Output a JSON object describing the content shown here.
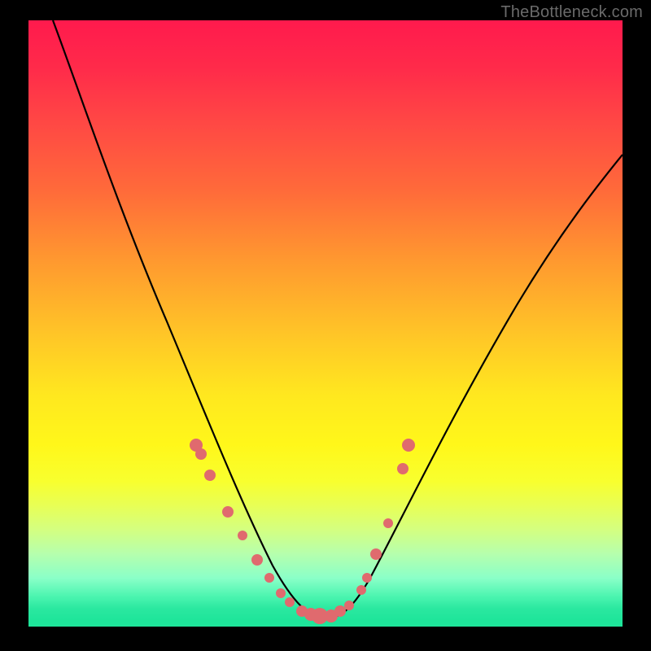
{
  "watermark": "TheBottleneck.com",
  "chart_data": {
    "type": "line",
    "title": "",
    "xlabel": "",
    "ylabel": "",
    "x_range": [
      0,
      100
    ],
    "y_range": [
      0,
      100
    ],
    "note": "V-shaped bottleneck curve over a vertical red-to-green gradient. Axes are unlabeled; values are visual estimates in percent of plot area (x left→right, y bottom→top).",
    "series": [
      {
        "name": "bottleneck-curve",
        "x": [
          4,
          10,
          16,
          22,
          28,
          32,
          36,
          40,
          43,
          46,
          48,
          50,
          53,
          56,
          60,
          66,
          74,
          84,
          94,
          100
        ],
        "y": [
          100,
          88,
          76,
          64,
          52,
          42,
          33,
          24,
          16,
          9,
          4,
          2,
          4,
          10,
          18,
          30,
          44,
          58,
          70,
          78
        ]
      }
    ],
    "markers": {
      "name": "highlighted-points",
      "x": [
        28.2,
        29.0,
        30.5,
        33.6,
        36.0,
        38.5,
        40.5,
        42.5,
        44.0,
        46.0,
        47.5,
        49.0,
        51.0,
        52.5,
        54.0,
        56.0,
        57.0,
        58.5,
        60.5,
        63.0,
        64.0
      ],
      "y": [
        30.0,
        28.5,
        25.0,
        19.0,
        15.0,
        11.0,
        8.0,
        5.5,
        4.0,
        2.5,
        2.0,
        2.0,
        2.0,
        2.5,
        3.5,
        6.0,
        8.0,
        12.0,
        17.0,
        26.0,
        30.0
      ],
      "r": [
        8,
        7,
        7,
        7,
        6,
        7,
        6,
        6,
        6,
        7,
        8,
        10,
        8,
        7,
        6,
        6,
        6,
        7,
        6,
        7,
        8
      ]
    },
    "gradient_stops": [
      {
        "pos": 0.0,
        "color": "#ff1a4d"
      },
      {
        "pos": 0.5,
        "color": "#ffc627"
      },
      {
        "pos": 0.8,
        "color": "#e8ff55"
      },
      {
        "pos": 1.0,
        "color": "#1ee59a"
      }
    ]
  }
}
